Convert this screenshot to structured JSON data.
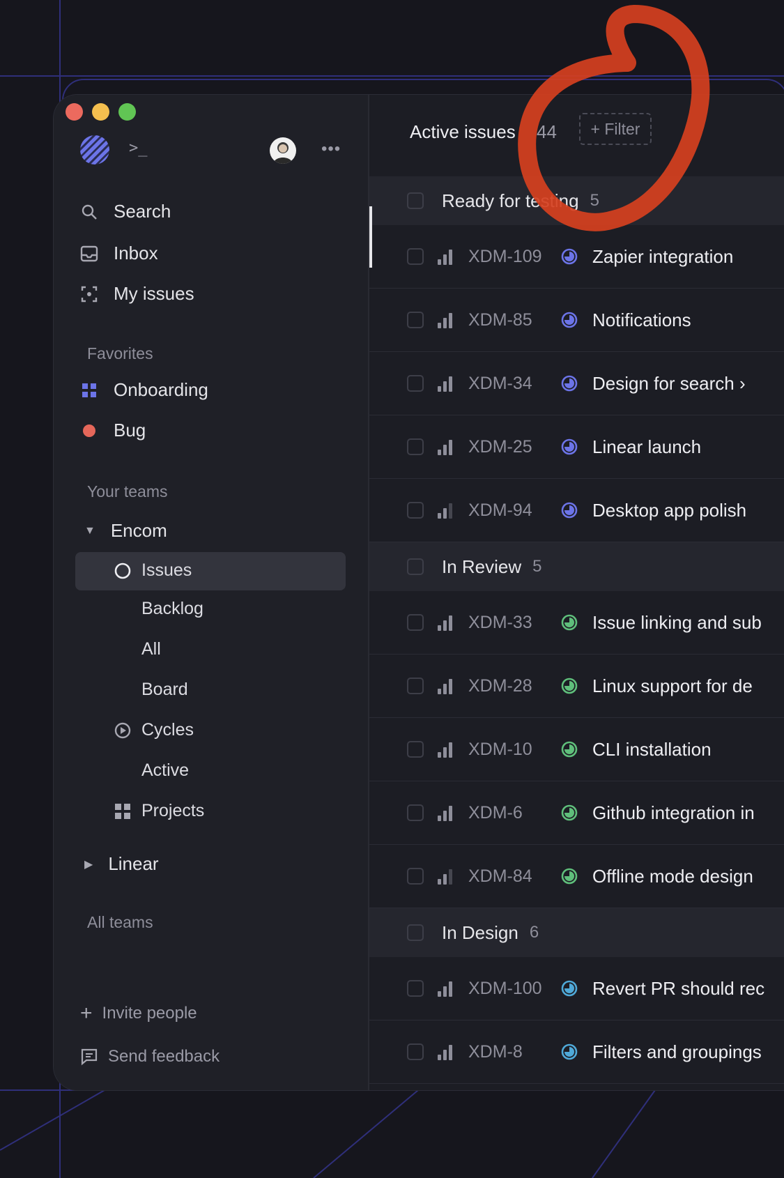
{
  "sidebar": {
    "nav": [
      {
        "label": "Search",
        "icon": "search-icon"
      },
      {
        "label": "Inbox",
        "icon": "inbox-icon"
      },
      {
        "label": "My issues",
        "icon": "my-issues-icon"
      }
    ],
    "favorites_label": "Favorites",
    "favorites": [
      {
        "label": "Onboarding",
        "icon": "grid-icon",
        "color": "#6c74e8"
      },
      {
        "label": "Bug",
        "icon": "dot-icon",
        "color": "#e5675a"
      }
    ],
    "teams_label": "Your teams",
    "team": {
      "name": "Encom",
      "items": [
        {
          "label": "Issues"
        },
        {
          "label": "Backlog"
        },
        {
          "label": "All"
        },
        {
          "label": "Board"
        },
        {
          "label": "Cycles"
        },
        {
          "label": "Active"
        },
        {
          "label": "Projects"
        }
      ]
    },
    "team2": {
      "name": "Linear"
    },
    "all_teams_label": "All teams",
    "invite_label": "Invite people",
    "feedback_label": "Send feedback"
  },
  "header": {
    "title": "Active issues",
    "count": "44",
    "filter_label": "+ Filter"
  },
  "groups": [
    {
      "name": "Ready for testing",
      "count": "5",
      "status_color": "#6c74e8",
      "issues": [
        {
          "id": "XDM-109",
          "title": "Zapier integration",
          "priority": 3
        },
        {
          "id": "XDM-85",
          "title": "Notifications",
          "priority": 3
        },
        {
          "id": "XDM-34",
          "title": "Design for search ›",
          "priority": 3
        },
        {
          "id": "XDM-25",
          "title": "Linear launch",
          "priority": 3
        },
        {
          "id": "XDM-94",
          "title": "Desktop app polish",
          "priority": 2
        }
      ]
    },
    {
      "name": "In Review",
      "count": "5",
      "status_color": "#5fbf7b",
      "issues": [
        {
          "id": "XDM-33",
          "title": "Issue linking and sub",
          "priority": 3
        },
        {
          "id": "XDM-28",
          "title": "Linux support for de",
          "priority": 3
        },
        {
          "id": "XDM-10",
          "title": "CLI installation",
          "priority": 3
        },
        {
          "id": "XDM-6",
          "title": "Github integration in",
          "priority": 3
        },
        {
          "id": "XDM-84",
          "title": "Offline mode design",
          "priority": 2
        }
      ]
    },
    {
      "name": "In Design",
      "count": "6",
      "status_color": "#4fa9d8",
      "issues": [
        {
          "id": "XDM-100",
          "title": "Revert PR should rec",
          "priority": 3
        },
        {
          "id": "XDM-8",
          "title": "Filters and groupings",
          "priority": 3
        }
      ]
    }
  ],
  "colors": {
    "accent": "#6c74e8",
    "annotation": "#d6401f"
  }
}
